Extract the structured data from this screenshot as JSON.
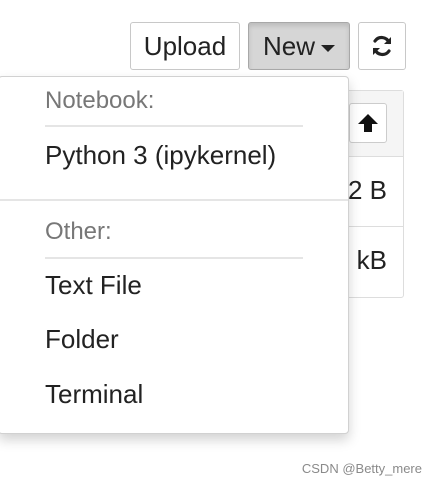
{
  "toolbar": {
    "upload_label": "Upload",
    "new_label": "New",
    "refresh_icon": "refresh-icon"
  },
  "background_list": {
    "sort_icon": "arrow-up-icon",
    "rows": [
      {
        "size_partial": "2 B"
      },
      {
        "size_partial": "kB"
      }
    ]
  },
  "new_menu": {
    "sections": [
      {
        "header": "Notebook:",
        "items": [
          "Python 3 (ipykernel)"
        ]
      },
      {
        "header": "Other:",
        "items": [
          "Text File",
          "Folder",
          "Terminal"
        ]
      }
    ]
  },
  "watermark": "CSDN @Betty_mere"
}
